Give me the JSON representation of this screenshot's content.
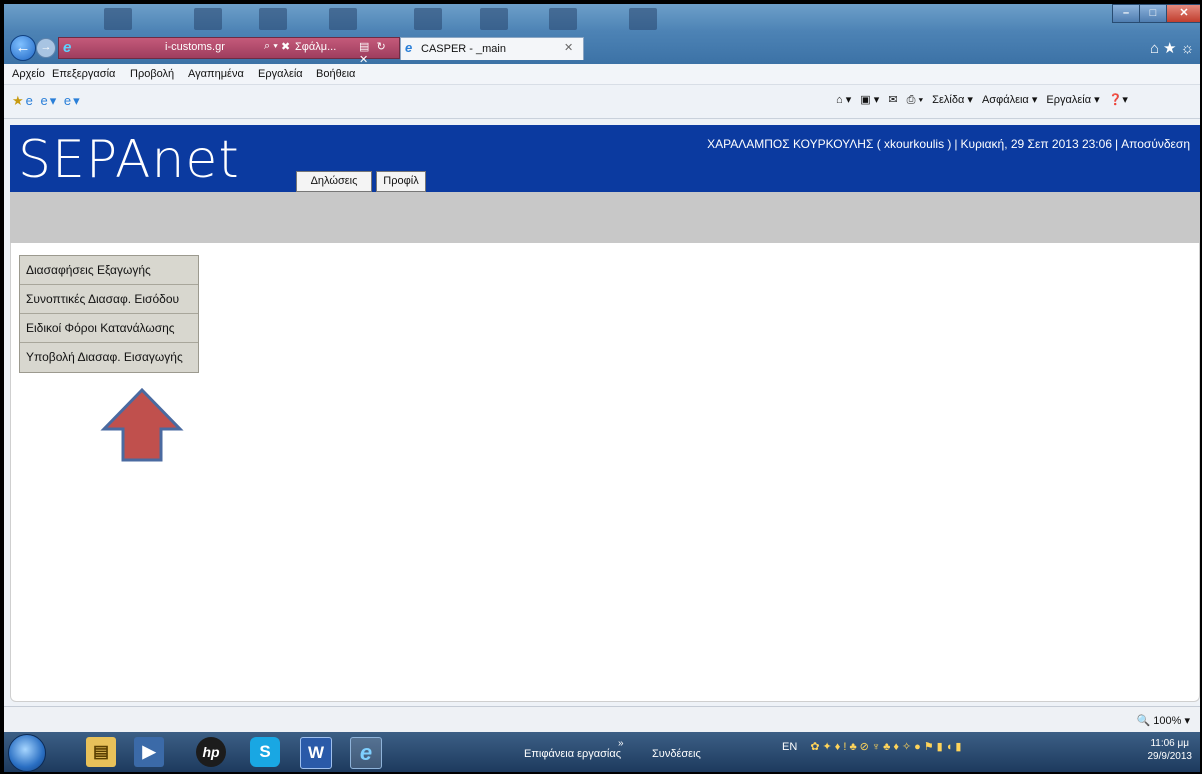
{
  "browser": {
    "address_text": "i-customs.gr",
    "error_tab_text": "Σφάλμ...",
    "active_tab_title": "CASPER - _main",
    "menu": [
      "Αρχείο",
      "Επεξεργασία",
      "Προβολή",
      "Αγαπημένα",
      "Εργαλεία",
      "Βοήθεια"
    ],
    "command_bar": {
      "page": "Σελίδα ▾",
      "safety": "Ασφάλεια ▾",
      "tools": "Εργαλεία ▾"
    },
    "zoom": "100%"
  },
  "site": {
    "logo": "SEPAnet",
    "tabs": [
      "Δηλώσεις",
      "Προφίλ"
    ],
    "user": {
      "name": "ΧΑΡΑΛΑΜΠΟΣ ΚΟΥΡΚΟΥΛΗΣ ( xkourkoulis )",
      "datetime": "Κυριακή, 29 Σεπ 2013 23:06",
      "logout": "Αποσύνδεση"
    },
    "side_menu": [
      "Διασαφήσεις Εξαγωγής",
      "Συνοπτικές Διασαφ. Εισόδου",
      "Ειδικοί Φόροι Κατανάλωσης",
      "Υποβολή Διασαφ. Εισαγωγής"
    ]
  },
  "taskbar": {
    "desktop_label": "Επιφάνεια εργασίας",
    "connections_label": "Συνδέσεις",
    "language": "EN",
    "time": "11:06 μμ",
    "date": "29/9/2013"
  },
  "colors": {
    "header_blue": "#0b3aa0",
    "arrow_fill": "#c0504d",
    "arrow_stroke": "#4a6aa0"
  }
}
